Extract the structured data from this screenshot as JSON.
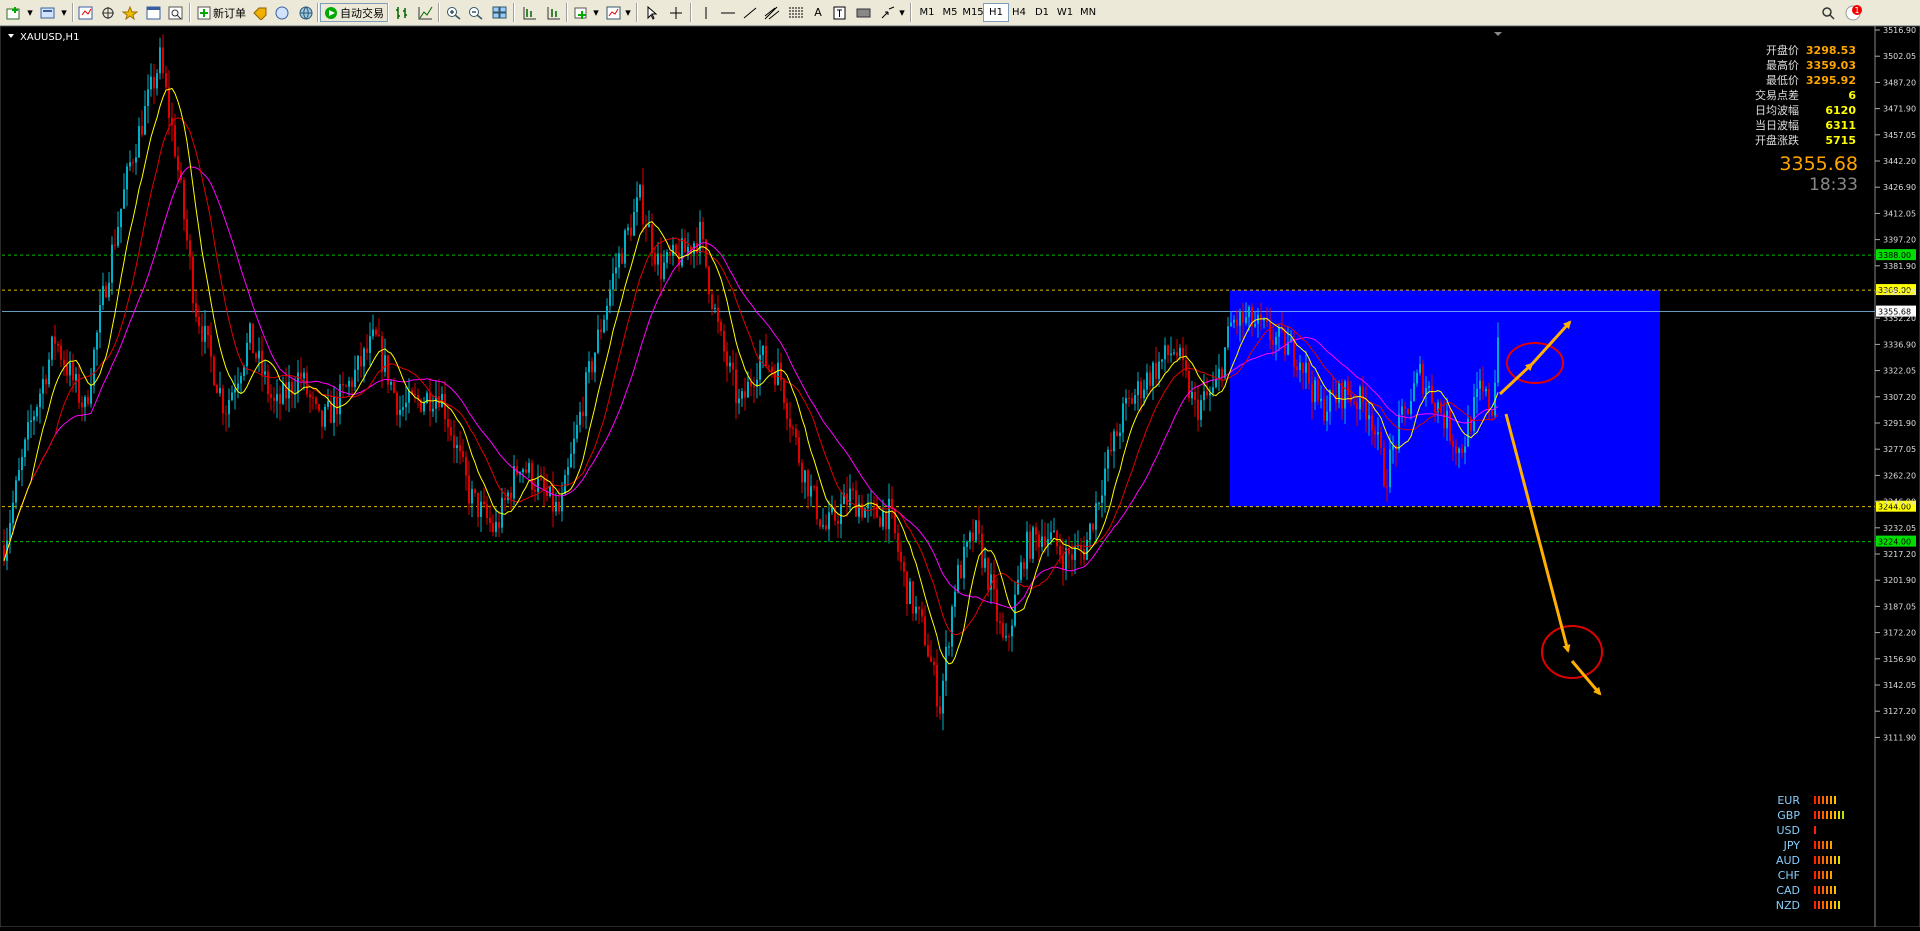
{
  "toolbar": {
    "new_order_label": "新订单",
    "auto_trade_label": "自动交易",
    "timeframes": [
      "M1",
      "M5",
      "M15",
      "H1",
      "H4",
      "D1",
      "W1",
      "MN"
    ],
    "active_timeframe": "H1",
    "notification_count": "1"
  },
  "chart": {
    "symbol_label": "XAUUSD,H1",
    "current_price": "3355.68",
    "countdown": "18:33",
    "info_panel": [
      {
        "label": "开盘价",
        "value": "3298.53",
        "color": "#ffa500"
      },
      {
        "label": "最高价",
        "value": "3359.03",
        "color": "#ffa500"
      },
      {
        "label": "最低价",
        "value": "3295.92",
        "color": "#ffa500"
      },
      {
        "label": "交易点差",
        "value": "6",
        "color": "#ffff00"
      },
      {
        "label": "日均波幅",
        "value": "6120",
        "color": "#ffff00"
      },
      {
        "label": "当日波幅",
        "value": "6311",
        "color": "#ffff00"
      },
      {
        "label": "开盘涨跌",
        "value": "5715",
        "color": "#ffff00"
      }
    ],
    "price_axis_labels": [
      "3516.90",
      "3502.05",
      "3487.20",
      "3471.90",
      "3457.05",
      "3442.20",
      "3426.90",
      "3412.05",
      "3397.20",
      "3381.90",
      "3367.05",
      "3352.20",
      "3336.90",
      "3322.05",
      "3307.20",
      "3291.90",
      "3277.05",
      "3262.20",
      "3246.90",
      "3232.05",
      "3217.20",
      "3201.90",
      "3187.05",
      "3172.20",
      "3156.90",
      "3142.05",
      "3127.20",
      "3111.90"
    ],
    "levels": [
      {
        "price": 3388,
        "label": "3388.00",
        "color": "#00c000",
        "label_bg": "#00dd00"
      },
      {
        "price": 3368,
        "label": "3368.00",
        "color": "#e0c000",
        "label_bg": "#ffff00"
      },
      {
        "price": 3244,
        "label": "3244.00",
        "color": "#e0c000",
        "label_bg": "#ffff00"
      },
      {
        "price": 3224,
        "label": "3224.00",
        "color": "#00c000",
        "label_bg": "#00dd00"
      }
    ],
    "current_line_color": "#87cefa",
    "box": {
      "from_price": 3368,
      "to_price": 3244,
      "color": "#0000ff"
    },
    "currency_strength": [
      {
        "name": "EUR",
        "bars": 6
      },
      {
        "name": "GBP",
        "bars": 8
      },
      {
        "name": "USD",
        "bars": 1
      },
      {
        "name": "JPY",
        "bars": 5
      },
      {
        "name": "AUD",
        "bars": 7
      },
      {
        "name": "CHF",
        "bars": 5
      },
      {
        "name": "CAD",
        "bars": 6
      },
      {
        "name": "NZD",
        "bars": 7
      }
    ],
    "colors": {
      "bull": "#00b0c8",
      "bear": "#e00000",
      "ma_fast": "#ffff00",
      "ma_mid": "#e00000",
      "ma_slow": "#ff00ff",
      "arrow": "#ffb000",
      "circle": "#e00000"
    }
  }
}
